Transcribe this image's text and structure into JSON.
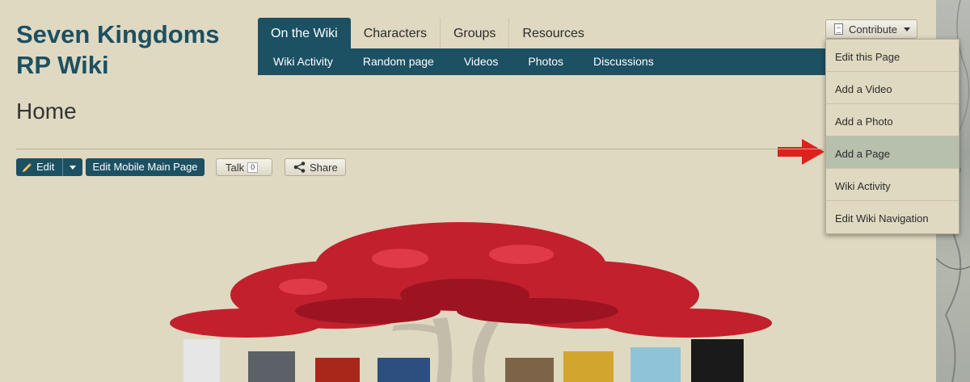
{
  "site": {
    "title": "Seven Kingdoms RP Wiki"
  },
  "nav": {
    "tabs": [
      {
        "label": "On the Wiki",
        "active": true
      },
      {
        "label": "Characters"
      },
      {
        "label": "Groups"
      },
      {
        "label": "Resources"
      }
    ],
    "subnav": [
      "Wiki Activity",
      "Random page",
      "Videos",
      "Photos",
      "Discussions"
    ]
  },
  "contribute": {
    "label": "Contribute",
    "menu": [
      {
        "label": "Edit this Page"
      },
      {
        "label": "Add a Video"
      },
      {
        "label": "Add a Photo"
      },
      {
        "label": "Add a Page",
        "highlighted": true
      },
      {
        "label": "Wiki Activity"
      },
      {
        "label": "Edit Wiki Navigation"
      }
    ]
  },
  "page": {
    "title": "Home",
    "actions": {
      "edit": "Edit",
      "edit_mobile": "Edit Mobile Main Page",
      "talk": "Talk",
      "talk_count": "0",
      "share": "Share"
    }
  },
  "colors": {
    "background": "#dfd9c1",
    "accent": "#1c5063",
    "highlight": "#b7bfad",
    "arrow": "#e0201c"
  },
  "icons": {
    "edit": "pencil-icon",
    "share": "share-icon",
    "contribute": "document-icon",
    "pointer": "red-arrow-icon"
  }
}
